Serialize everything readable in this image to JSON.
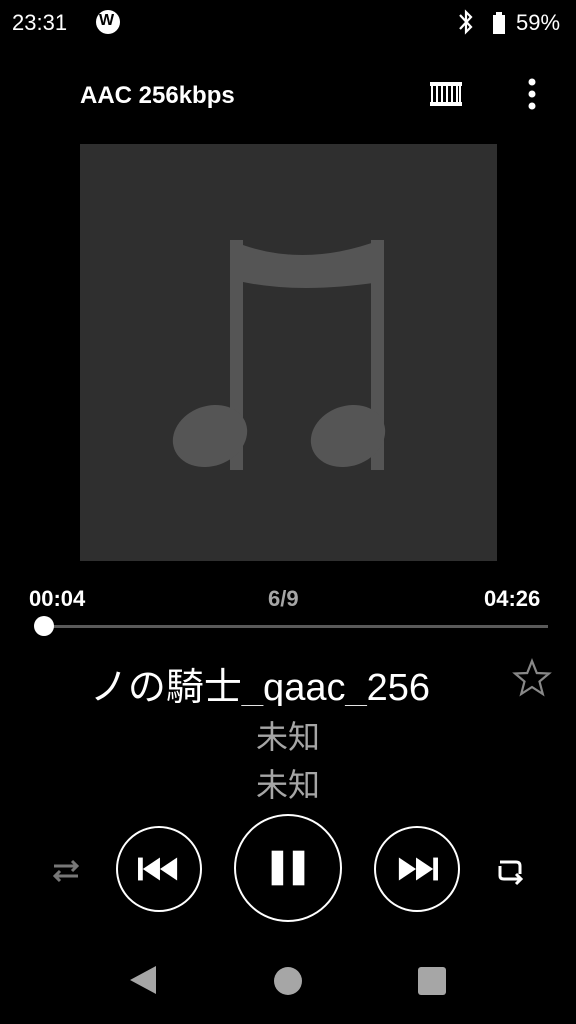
{
  "status_bar": {
    "time": "23:31",
    "battery_percent": "59%",
    "app_icon": "walkman-icon",
    "bluetooth_icon": "bluetooth-icon",
    "battery_icon": "battery-icon"
  },
  "header": {
    "codec_label": "AAC 256kbps",
    "eq_icon": "equalizer-icon",
    "menu_icon": "more-vert-icon"
  },
  "artwork": {
    "placeholder_icon": "music-note-icon",
    "bg_color": "#2f2f2f"
  },
  "progress": {
    "current_time": "00:04",
    "track_index": "6/9",
    "total_time": "04:26",
    "fraction": 0.015
  },
  "track": {
    "title": "ノの騎士_qaac_256",
    "artist": "未知",
    "album": "未知",
    "favorite_icon": "star-outline-icon"
  },
  "controls": {
    "shuffle_icon": "shuffle-icon",
    "prev_icon": "skip-previous-icon",
    "play_pause_icon": "pause-icon",
    "next_icon": "skip-next-icon",
    "repeat_icon": "repeat-icon"
  },
  "nav": {
    "back_icon": "back-icon",
    "home_icon": "home-icon",
    "recents_icon": "recents-icon"
  }
}
